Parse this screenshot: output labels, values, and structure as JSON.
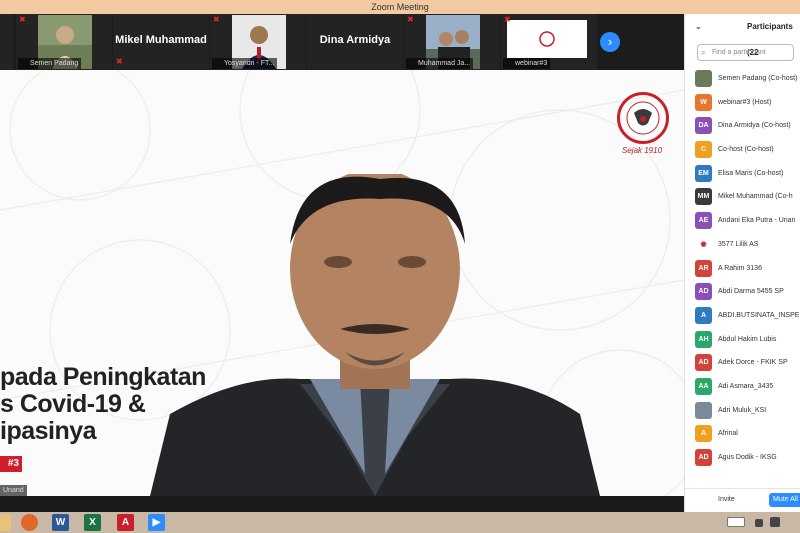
{
  "window": {
    "title": "Zoom Meeting"
  },
  "gallery": {
    "tiles": [
      {
        "label": "Semen Padang"
      },
      {
        "name": "Mikel Muhammad"
      },
      {
        "label": "Yosyandri - FT..."
      },
      {
        "name": "Dina Armidya"
      },
      {
        "label": "Muhammad Ja..."
      },
      {
        "label": "webinar#3"
      }
    ],
    "next_icon": "chevron-right-icon"
  },
  "slide": {
    "line1": "pada Peningkatan",
    "line2": "s Covid-19 &",
    "line3": "ipasinya",
    "tag": "#3",
    "speaker_label": "Unand",
    "logo_text": "PADANG CEMENT INDONESIA",
    "logo_subtitle": "Sejak 1910"
  },
  "participants": {
    "header": "Participants (22",
    "search_placeholder": "Find a participant",
    "items": [
      {
        "initials": "",
        "name": "Semen Padang (Co-host)",
        "color": "#6b7b5a"
      },
      {
        "initials": "W",
        "name": "webinar#3 (Host)",
        "color": "#e8772e"
      },
      {
        "initials": "DA",
        "name": "Dina Armidya (Co-host)",
        "color": "#8b4fb8"
      },
      {
        "initials": "C",
        "name": "Co-host (Co-host)",
        "color": "#f0a020"
      },
      {
        "initials": "EM",
        "name": "Elisa Maris (Co-host)",
        "color": "#2e7bbf"
      },
      {
        "initials": "MM",
        "name": "Mikel Muhammad (Co-h",
        "color": "#3a3a3a"
      },
      {
        "initials": "AE",
        "name": "Andani Eka Putra - Unan",
        "color": "#8b4fb8"
      },
      {
        "initials": "◉",
        "name": "3577 Lilik AS",
        "color": "#ffffff"
      },
      {
        "initials": "AR",
        "name": "A Rahim 3136",
        "color": "#d2433a"
      },
      {
        "initials": "AD",
        "name": "Abdi Darma 5455 SP",
        "color": "#8b4fb8"
      },
      {
        "initials": "A",
        "name": "ABDI.BUTSINATA_INSPE",
        "color": "#2e7bbf"
      },
      {
        "initials": "AH",
        "name": "Abdul Hakim Lubis",
        "color": "#2aa86a"
      },
      {
        "initials": "AD",
        "name": "Adek Dorce - FKIK SP",
        "color": "#d2433a"
      },
      {
        "initials": "AA",
        "name": "Adi Asmara_3435",
        "color": "#2aa86a"
      },
      {
        "initials": "",
        "name": "Adri Muluk_KSI",
        "color": "#7a8a9a"
      },
      {
        "initials": "A",
        "name": "Afrinal",
        "color": "#f0a020"
      },
      {
        "initials": "AD",
        "name": "Agus Dodik - IKSG",
        "color": "#d2433a"
      }
    ],
    "invite_label": "Invite",
    "mute_all_label": "Mute All"
  },
  "taskbar": {
    "apps": [
      "file-explorer-icon",
      "firefox-icon",
      "word-icon",
      "excel-icon",
      "acrobat-icon",
      "zoom-icon"
    ]
  }
}
